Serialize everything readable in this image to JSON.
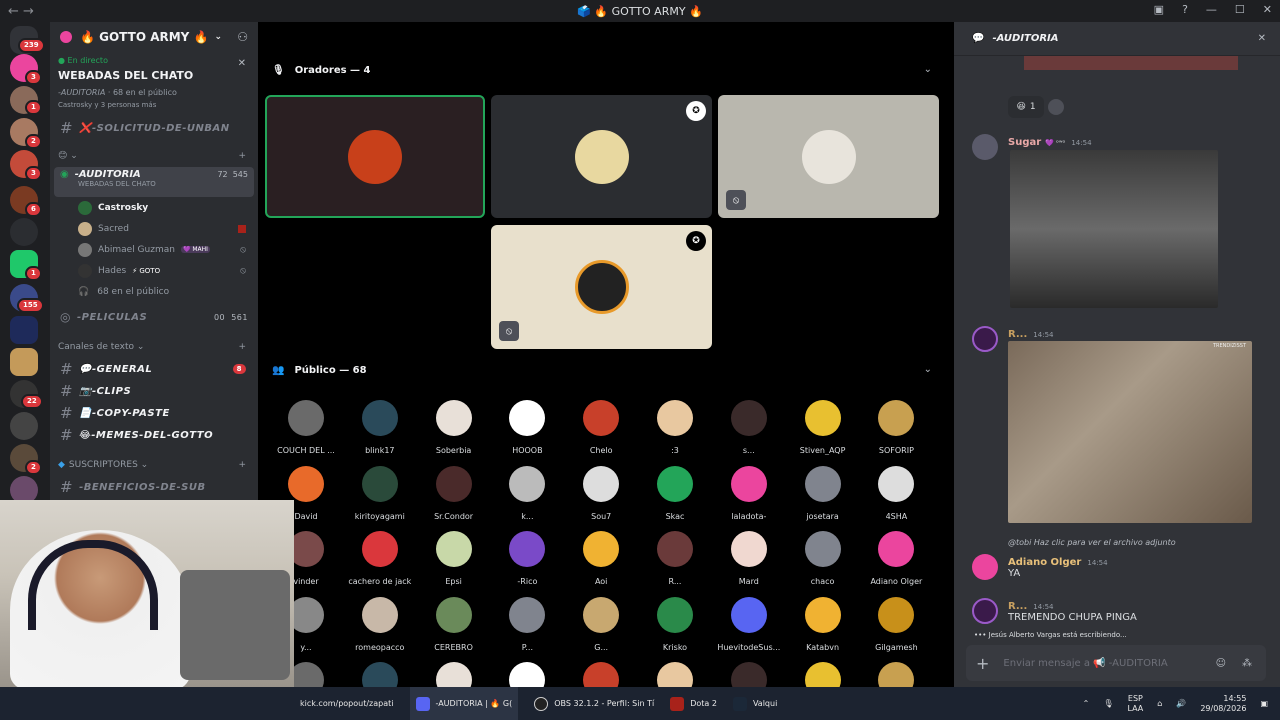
{
  "window": {
    "title": "🗳️ 🔥 GOTTO ARMY 🔥"
  },
  "guilds": {
    "home_badge": "239",
    "badges": [
      "3",
      "1",
      "2",
      "3",
      "6",
      "1",
      "155",
      "22",
      "2"
    ]
  },
  "server": {
    "name": "🔥 GOTTO ARMY 🔥"
  },
  "live": {
    "status": "En directo",
    "title": "WEBADAS DEL CHATO",
    "channel": "-AUDITORIA",
    "public": "68 en el público",
    "viewers": "Castrosky y 3 personas más"
  },
  "channels": {
    "unban": "❌-SOLICITUD-DE-UNBAN",
    "auditoria": "-AUDITORIA",
    "auditoria_sub": "WEBADAS DEL CHATO",
    "auditoria_counts": [
      "72",
      "545"
    ],
    "members": [
      {
        "name": "Castrosky",
        "tag": ""
      },
      {
        "name": "Sacred",
        "tag": ""
      },
      {
        "name": "Abimael Guzman",
        "tag": "💜 MAHI"
      },
      {
        "name": "Hades",
        "tag": "⚡ GOTO"
      }
    ],
    "public_line": "68 en el público",
    "peliculas": "-PELICULAS",
    "peliculas_counts": [
      "00",
      "561"
    ],
    "text_section": "Canales de texto",
    "text": [
      {
        "name": "💬-GENERAL",
        "badge": "8"
      },
      {
        "name": "📷-CLIPS",
        "badge": ""
      },
      {
        "name": "📄-COPY-PASTE",
        "badge": ""
      },
      {
        "name": "😂-MEMES-DEL-GOTTO",
        "badge": ""
      }
    ],
    "subs": "SUSCRIPTORES",
    "subs_item": "-BENEFICIOS-DE-SUB"
  },
  "stage": {
    "speakers_label": "Oradores — 4",
    "public_label": "Público — 68",
    "audience": [
      [
        "COUCH DEL ...",
        "blink17",
        "Soberbia",
        "HOOOB",
        "Chelo",
        ":3",
        "s...",
        "Stiven_AQP",
        "SOFORIP"
      ],
      [
        "David",
        "kiritoyagami",
        "Sr.Condor",
        "k...",
        "Sou7",
        "Skac",
        "laladota-",
        "josetara",
        "4SHA"
      ],
      [
        "vinder",
        "cachero de jack",
        "Epsi",
        "-Rico",
        "Aoi",
        "R...",
        "Mard",
        "chaco",
        "Adiano Olger"
      ],
      [
        "y...",
        "romeopacco",
        "CEREBRO",
        "P...",
        "G...",
        "Krisko",
        "HuevitodeSus...",
        "Katabvn",
        "Gilgamesh"
      ]
    ]
  },
  "chat": {
    "channel": "-AUDITORIA",
    "reaction_count": "1",
    "messages": [
      {
        "user": "Sugar",
        "tag": "💜 ᵒʷᵒ",
        "time": "14:54",
        "text": ""
      },
      {
        "user": "R...",
        "tag": "",
        "time": "14:54",
        "text": "",
        "gif_caption": "TRENDIZISST"
      },
      {
        "reply": "@tobi Haz clic para ver el archivo adjunto",
        "user": "Adiano Olger",
        "time": "14:54",
        "text": "YA"
      },
      {
        "user": "R...",
        "tag": "",
        "time": "14:54",
        "text": "TREMENDO CHUPA PINGA"
      }
    ],
    "typing": "Jesús Alberto Vargas está escribiendo...",
    "input_placeholder": "Enviar mensaje a 📢 -AUDITORIA"
  },
  "taskbar": {
    "items": [
      "kick.com/popout/zapati",
      "-AUDITORIA | 🔥 G(",
      "OBS 32.1.2 - Perfil: Sin Tí",
      "Dota 2",
      "Valqui"
    ],
    "lang": "ESP",
    "lang2": "LAA",
    "time": "14:55",
    "date": "29/08/2026"
  }
}
